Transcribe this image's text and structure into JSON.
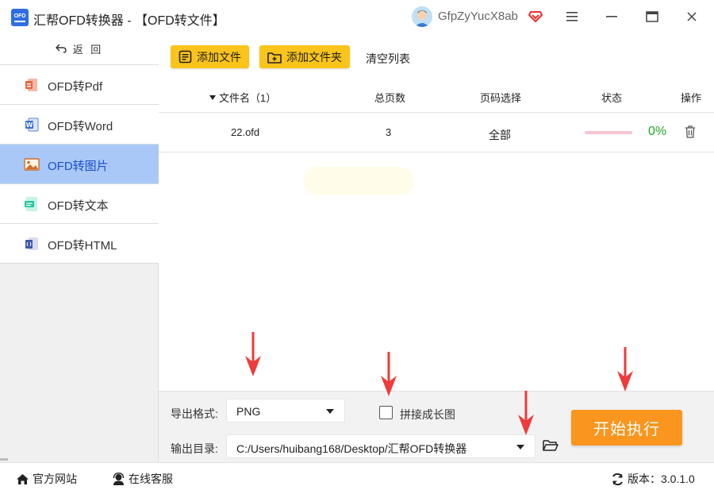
{
  "window": {
    "logo_text_top": "OFD",
    "title": "汇帮OFD转换器 - 【OFD转文件】",
    "username": "GfpZyYucX8ab"
  },
  "sidebar": {
    "back_label": "返 回",
    "items": [
      {
        "label": "OFD转Pdf",
        "icon": "pdf-icon",
        "active": false
      },
      {
        "label": "OFD转Word",
        "icon": "word-icon",
        "active": false
      },
      {
        "label": "OFD转图片",
        "icon": "image-icon",
        "active": true
      },
      {
        "label": "OFD转文本",
        "icon": "text-icon",
        "active": false
      },
      {
        "label": "OFD转HTML",
        "icon": "html-icon",
        "active": false
      }
    ]
  },
  "toolbar": {
    "add_file": "添加文件",
    "add_folder": "添加文件夹",
    "clear_list": "清空列表"
  },
  "table": {
    "headers": {
      "filename": "文件名（1）",
      "pages": "总页数",
      "page_select": "页码选择",
      "status": "状态",
      "action": "操作"
    },
    "rows": [
      {
        "filename": "22.ofd",
        "pages": "3",
        "page_select": "全部",
        "progress_text": "0%",
        "progress": 0
      }
    ]
  },
  "settings": {
    "format_label": "导出格式:",
    "format_value": "PNG",
    "merge_label": "拼接成长图",
    "merge_checked": false,
    "output_label": "输出目录:",
    "output_path": "C:/Users/huibang168/Desktop/汇帮OFD转换器",
    "start_button": "开始执行"
  },
  "statusbar": {
    "website": "官方网站",
    "support": "在线客服",
    "version_label": "版本：",
    "version": "3.0.1.0"
  },
  "colors": {
    "accent_yellow": "#fbc41a",
    "start_orange": "#fa951d",
    "active_nav": "#a9c8f8",
    "progress_green": "#27a527",
    "arrow_red": "#ee3b3b"
  }
}
